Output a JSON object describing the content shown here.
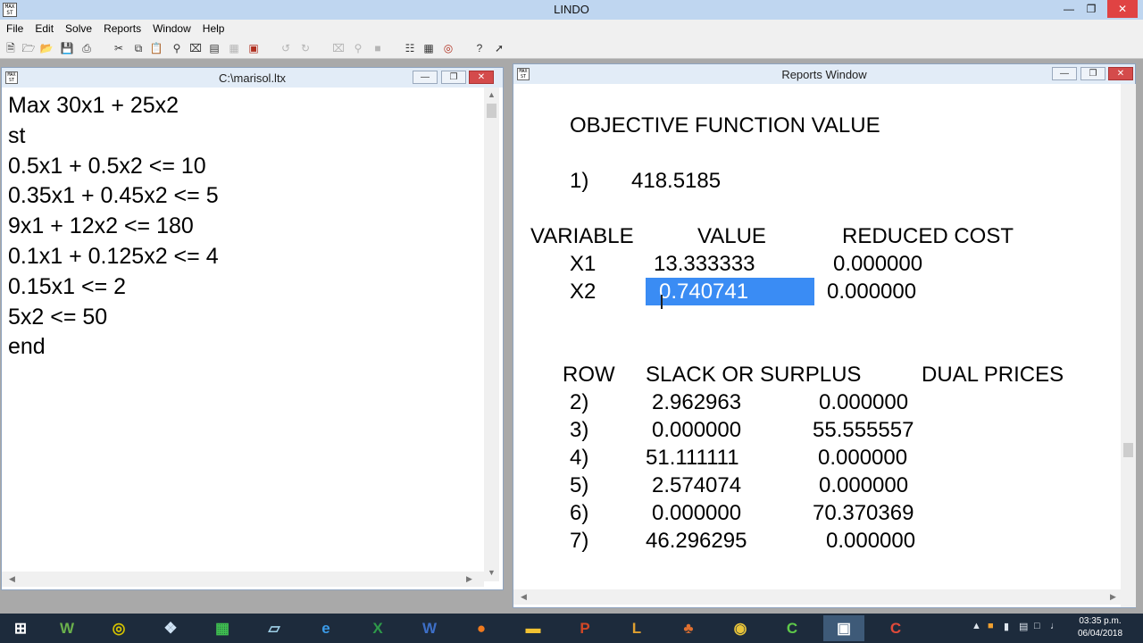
{
  "app": {
    "title": "LINDO",
    "icon_text": "MAX ST"
  },
  "menu": [
    "File",
    "Edit",
    "Solve",
    "Reports",
    "Window",
    "Help"
  ],
  "toolbar_icons": [
    "new-file-icon",
    "open-folder-icon",
    "open-icon",
    "save-icon",
    "print-icon",
    "cut-icon",
    "copy-icon",
    "paste-icon",
    "find-icon",
    "clear-icon",
    "send-to-back-icon",
    "tile-icon",
    "compile-icon",
    "undo-icon",
    "redo-icon",
    "close-window-icon",
    "zoom-icon",
    "window-icon",
    "tile-windows-icon",
    "cascade-icon",
    "solve-icon",
    "help-icon",
    "context-help-icon"
  ],
  "editor_window": {
    "title": "C:\\marisol.ltx",
    "lines": [
      "Max 30x1 + 25x2",
      "st",
      "0.5x1 + 0.5x2 <= 10",
      "0.35x1 + 0.45x2 <= 5",
      "9x1 + 12x2 <= 180",
      "0.1x1 + 0.125x2 <= 4",
      "0.15x1 <= 2",
      "5x2 <= 50",
      "end"
    ]
  },
  "reports_window": {
    "title": "Reports Window",
    "objective_header": "OBJECTIVE FUNCTION VALUE",
    "objective_row": "1)",
    "objective_value": "418.5185",
    "variable_headers": [
      "VARIABLE",
      "VALUE",
      "REDUCED COST"
    ],
    "variables": [
      {
        "name": "X1",
        "value": "13.333333",
        "reduced_cost": "0.000000"
      },
      {
        "name": "X2",
        "value": "0.740741",
        "reduced_cost": "0.000000"
      }
    ],
    "row_headers": [
      "ROW",
      "SLACK OR SURPLUS",
      "DUAL PRICES"
    ],
    "rows": [
      {
        "row": "2)",
        "slack": "2.962963",
        "dual": "0.000000"
      },
      {
        "row": "3)",
        "slack": "0.000000",
        "dual": "55.555557"
      },
      {
        "row": "4)",
        "slack": "51.111111",
        "dual": "0.000000"
      },
      {
        "row": "5)",
        "slack": "2.574074",
        "dual": "0.000000"
      },
      {
        "row": "6)",
        "slack": "0.000000",
        "dual": "70.370369"
      },
      {
        "row": "7)",
        "slack": "46.296295",
        "dual": "0.000000"
      }
    ]
  },
  "taskbar": {
    "items": [
      {
        "name": "start",
        "glyph": "⊞",
        "color": "#ffffff"
      },
      {
        "name": "word-alt",
        "glyph": "W",
        "color": "#6ab04c"
      },
      {
        "name": "geogebra",
        "glyph": "◎",
        "color": "#d4c200"
      },
      {
        "name": "dropbox",
        "glyph": "❖",
        "color": "#cfe3f5"
      },
      {
        "name": "spreadsheet",
        "glyph": "▦",
        "color": "#3fbf50"
      },
      {
        "name": "notes",
        "glyph": "▱",
        "color": "#9fd0e8"
      },
      {
        "name": "internet-explorer",
        "glyph": "e",
        "color": "#3b9be8"
      },
      {
        "name": "excel",
        "glyph": "X",
        "color": "#2e9a4a"
      },
      {
        "name": "word",
        "glyph": "W",
        "color": "#3d6fc7"
      },
      {
        "name": "firefox",
        "glyph": "●",
        "color": "#f07a1e"
      },
      {
        "name": "file-explorer",
        "glyph": "▬",
        "color": "#f1c232"
      },
      {
        "name": "powerpoint",
        "glyph": "P",
        "color": "#d24726"
      },
      {
        "name": "lindo-alt",
        "glyph": "L",
        "color": "#e0a030"
      },
      {
        "name": "mushroom-app",
        "glyph": "♣",
        "color": "#e07030"
      },
      {
        "name": "chrome",
        "glyph": "◉",
        "color": "#e8c43a"
      },
      {
        "name": "camtasia",
        "glyph": "C",
        "color": "#5ec94a"
      },
      {
        "name": "lindo",
        "glyph": "▣",
        "color": "#ffffff"
      },
      {
        "name": "camtasia-recorder",
        "glyph": "C",
        "color": "#e04a3a"
      }
    ],
    "time": "03:35 p.m.",
    "date": "06/04/2018"
  }
}
